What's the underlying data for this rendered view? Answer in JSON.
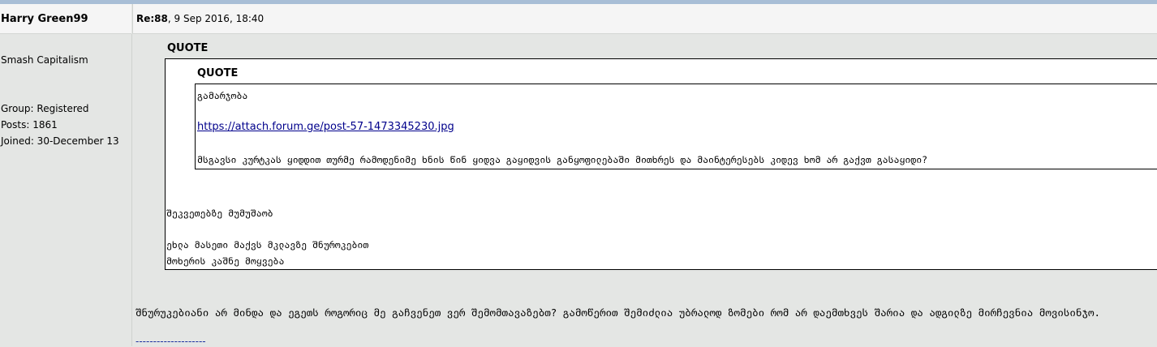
{
  "author": {
    "name": "Harry Green99",
    "title": "Smash Capitalism",
    "group": "Group: Registered",
    "posts": "Posts: 1861",
    "joined": "Joined: 30-December 13"
  },
  "post": {
    "ref": "Re:88",
    "date": ", 9 Sep 2016, 18:40"
  },
  "quote_outer": {
    "label": "QUOTE",
    "lines": [
      "შეკვეთებზე მუმუშაობ",
      "ეხლა მასეთი მაქვს მკლავზე შნუროკებით",
      "მოხერის კაშნე მოყვება"
    ]
  },
  "quote_inner": {
    "label": "QUOTE",
    "first_line": "გამარჯობა",
    "link": "https://attach.forum.ge/post-57-1473345230.jpg",
    "last_line": "მსგავსი კურტკას ყიდდით თურმე რამოდენიმე ხნის წინ ყიდვა გაყიდვის განყოფილებაში მითხრეს და მაინტერესებს კიდევ ხომ არ გაქვთ გასაყიდი?"
  },
  "reply_text": "შნურუკებიანი არ მინდა და ეგეთს როგორიც მე გაჩვენეთ ვერ შემომთავაზებთ? გამოწერით შემიძლია უბრალოდ ზომები რომ არ დაემთხვეს შარია და ადგილზე მირჩევნია მოვისინჯო.",
  "signature_separator": "--------------------"
}
